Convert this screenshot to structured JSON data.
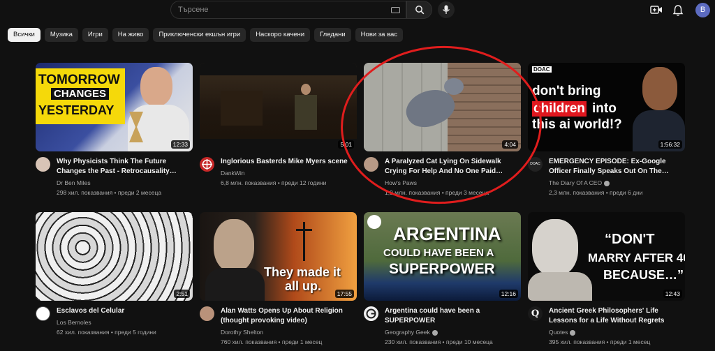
{
  "search": {
    "placeholder": "Търсене"
  },
  "user": {
    "avatar_letter": "B"
  },
  "chips": [
    "Всички",
    "Музика",
    "Игри",
    "На живо",
    "Приключенски екшън игри",
    "Наскоро качени",
    "Гледани",
    "Нови за вас"
  ],
  "videos": [
    {
      "title": "Why Physicists Think The Future Changes the Past - Retrocausality…",
      "channel": "Dr Ben Miles",
      "stats": "298 хил. показвания • преди 2 месеца",
      "duration": "12:33",
      "overlay": [
        "TOMORROW",
        "CHANGES",
        "YESTERDAY"
      ]
    },
    {
      "title": "Inglorious Basterds Mike Myers scene",
      "channel": "DankWin",
      "stats": "6,8 млн. показвания • преди 12 години",
      "duration": "5:01"
    },
    {
      "title": "A Paralyzed Cat Lying On Sidewalk Crying For Help And No One Paid…",
      "channel": "How's Paws",
      "stats": "1,9 млн. показвания • преди 3 месеца",
      "duration": "4:04"
    },
    {
      "title": "EMERGENCY EPISODE: Ex-Google Officer Finally Speaks Out On The…",
      "channel": "The Diary Of A CEO",
      "stats": "2,3 млн. показвания • преди 6 дни",
      "duration": "1:56:32",
      "overlay": [
        "DOAC",
        "don't bring",
        "children",
        "into",
        "this ai world!?"
      ]
    },
    {
      "title": "Esclavos del Celular",
      "channel": "Los Bernoles",
      "stats": "62 хил. показвания • преди 5 години",
      "duration": "2:51"
    },
    {
      "title": "Alan Watts Opens Up About Religion (thought provoking video)",
      "channel": "Dorothy Shelton",
      "stats": "760 хил. показвания • преди 1 месец",
      "duration": "17:55",
      "overlay": [
        "They made it",
        "all up."
      ]
    },
    {
      "title": "Argentina could have been a SUPERPOWER",
      "channel": "Geography Geek",
      "stats": "230 хил. показвания • преди 10 месеца",
      "duration": "12:16",
      "overlay": [
        "ARGENTINA",
        "COULD HAVE BEEN A",
        "SUPERPOWER"
      ]
    },
    {
      "title": "Ancient Greek Philosophers' Life Lessons for a Life Without Regrets",
      "channel": "Quotes",
      "stats": "395 хил. показвания • преди 1 месец",
      "duration": "12:43",
      "overlay": [
        "“DON'T",
        "MARRY AFTER 40,",
        "BECAUSE…”",
        "Q"
      ]
    }
  ],
  "colors": {
    "background": "#0f0f0f",
    "highlight_circle": "#e01d1d",
    "chip_active": "#f1f1f1"
  }
}
